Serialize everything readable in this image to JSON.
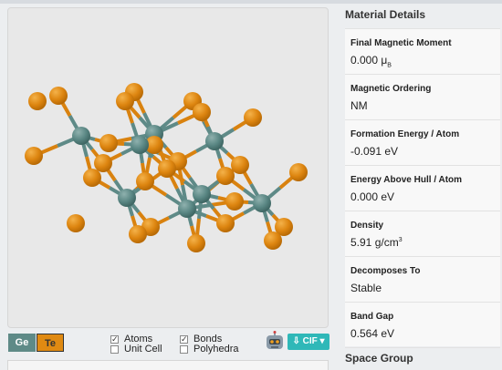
{
  "elements": [
    {
      "symbol": "Ge",
      "color": "#5e8a87"
    },
    {
      "symbol": "Te",
      "color": "#e08a12"
    }
  ],
  "display_options": {
    "atoms": {
      "label": "Atoms",
      "checked": true
    },
    "unit_cell": {
      "label": "Unit Cell",
      "checked": false
    },
    "bonds": {
      "label": "Bonds",
      "checked": true
    },
    "polyhedra": {
      "label": "Polyhedra",
      "checked": false
    }
  },
  "download": {
    "label": "CIF",
    "icon": "chevron-down-icon"
  },
  "material_details": {
    "title": "Material Details",
    "properties": [
      {
        "label": "Final Magnetic Moment",
        "value": "0.000 μ",
        "sub": "B",
        "sup": ""
      },
      {
        "label": "Magnetic Ordering",
        "value": "NM",
        "sub": "",
        "sup": ""
      },
      {
        "label": "Formation Energy / Atom",
        "value": "-0.091 eV",
        "sub": "",
        "sup": ""
      },
      {
        "label": "Energy Above Hull / Atom",
        "value": "0.000 eV",
        "sub": "",
        "sup": ""
      },
      {
        "label": "Density",
        "value": "5.91 g/cm",
        "sub": "",
        "sup": "3"
      },
      {
        "label": "Decomposes To",
        "value": "Stable",
        "sub": "",
        "sup": ""
      },
      {
        "label": "Band Gap",
        "value": "0.564 eV",
        "sub": "",
        "sup": ""
      }
    ]
  },
  "space_group": {
    "title": "Space Group"
  }
}
